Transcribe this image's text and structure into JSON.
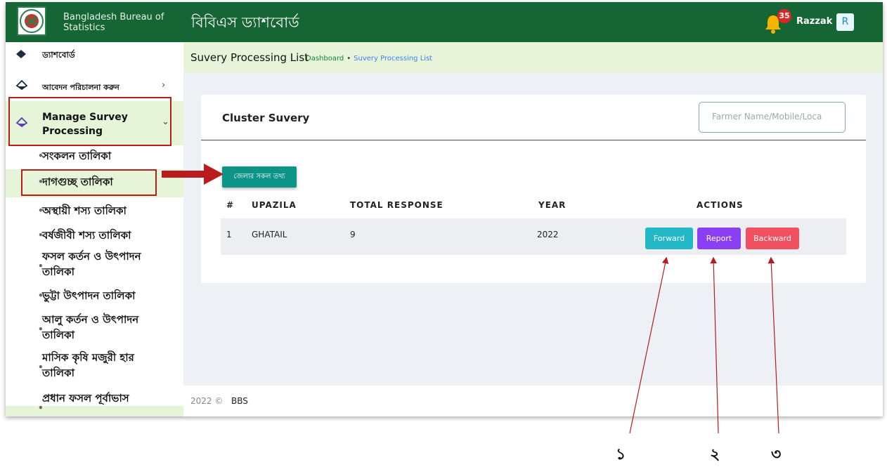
{
  "header": {
    "org_name": "Bangladesh Bureau of Statistics",
    "app_title": "বিবিএস ড্যাশবোর্ড",
    "notifications_count": "35",
    "username": "Razzak",
    "avatar_initial": "R"
  },
  "sidebar": {
    "dashboard": "ড্যাশবোর্ড",
    "manage_applications": "আবেদন পরিচালনা করুন",
    "manage_survey_line1": "Manage Survey",
    "manage_survey_line2": "Processing",
    "sub_items": [
      "সংকলন তালিকা",
      "দাগগুচ্ছ তালিকা",
      "অস্থায়ী শস্য তালিকা",
      "বর্ষজীবী শস্য তালিকা",
      "ফসল কর্তন ও উৎপাদন",
      "তালিকা",
      "ভুট্টা উৎপাদন তালিকা",
      "আলু কর্তন ও উৎপাদন",
      "তালিকা",
      "মাসিক কৃষি মজুরী হার",
      "তালিকা",
      "প্রধান ফসল পূর্বাভাস"
    ]
  },
  "breadcrumb": {
    "page_title": "Suvery Processing List",
    "home": "Dashboard",
    "separator": "•",
    "current": "Suvery Processing List"
  },
  "card": {
    "title": "Cluster Suvery",
    "search_placeholder": "Farmer Name/Mobile/Loca",
    "district_button": "জেলার সকল তথ্য",
    "columns": [
      "#",
      "UPAZILA",
      "TOTAL RESPONSE",
      "YEAR",
      "ACTIONS"
    ],
    "rows": [
      {
        "index": "1",
        "upazila": "GHATAIL",
        "total_response": "9",
        "year": "2022"
      }
    ],
    "actions": {
      "forward": "Forward",
      "report": "Report",
      "backward": "Backward"
    }
  },
  "footer": {
    "year": "2022 ©",
    "org": "BBS"
  },
  "annotations": {
    "label_1": "১",
    "label_2": "২",
    "label_3": "৩"
  },
  "colors": {
    "header_bg": "#166534",
    "accent_green": "#e6f4d7",
    "forward": "#22b8c8",
    "report": "#8b3ff5",
    "backward": "#f0505f",
    "district_button": "#0d9488",
    "annotation_red": "#b91c1c"
  }
}
